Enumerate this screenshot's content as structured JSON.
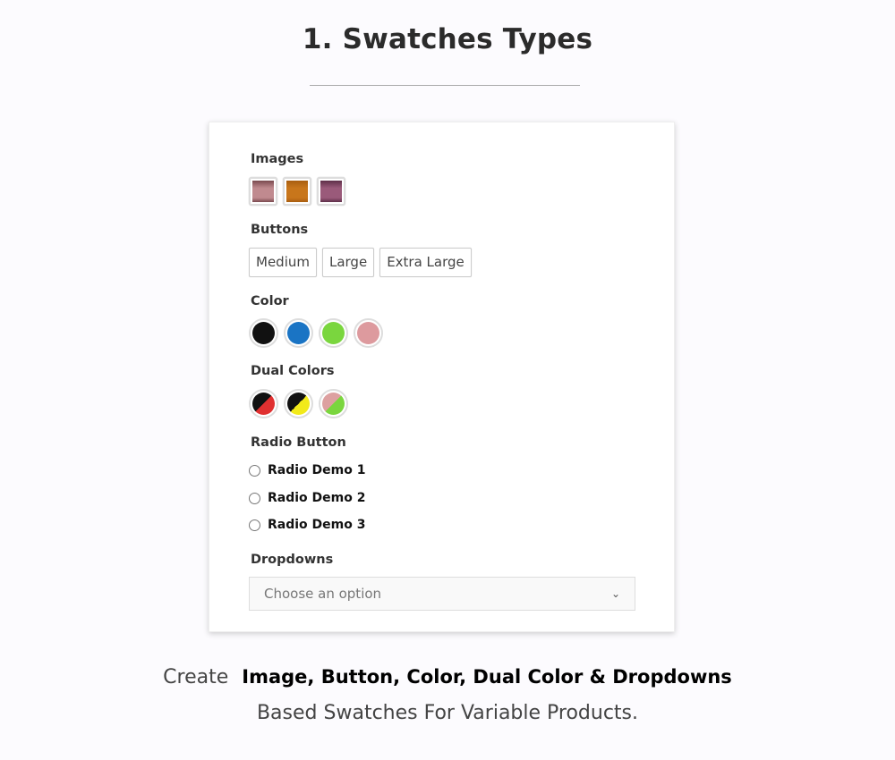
{
  "header": {
    "title": "1. Swatches Types"
  },
  "card": {
    "images": {
      "label": "Images",
      "items": [
        {
          "name": "pink-dress",
          "color": "#c08a8f",
          "accent": "#7a4a4f"
        },
        {
          "name": "mustard-dress",
          "color": "#c8761b",
          "accent": "#a85e10"
        },
        {
          "name": "purple-dress",
          "color": "#9a5a7a",
          "accent": "#5e2f48"
        }
      ]
    },
    "buttons": {
      "label": "Buttons",
      "items": [
        "Medium",
        "Large",
        "Extra Large"
      ]
    },
    "color": {
      "label": "Color",
      "items": [
        "#111111",
        "#1a74c4",
        "#7ad63e",
        "#dd9a9e"
      ]
    },
    "dual_colors": {
      "label": "Dual Colors",
      "items": [
        {
          "a": "#111111",
          "b": "#e03030"
        },
        {
          "a": "#111111",
          "b": "#f2ea1a"
        },
        {
          "a": "#dda0a0",
          "b": "#7ad63e"
        }
      ]
    },
    "radio": {
      "label": "Radio Button",
      "items": [
        "Radio Demo 1",
        "Radio Demo 2",
        "Radio Demo 3"
      ]
    },
    "dropdown": {
      "label": "Dropdowns",
      "placeholder": "Choose an option"
    }
  },
  "footer": {
    "lead": "Create",
    "emphasis": "Image, Button, Color, Dual Color & Dropdowns",
    "line2": "Based Swatches For Variable Products."
  }
}
